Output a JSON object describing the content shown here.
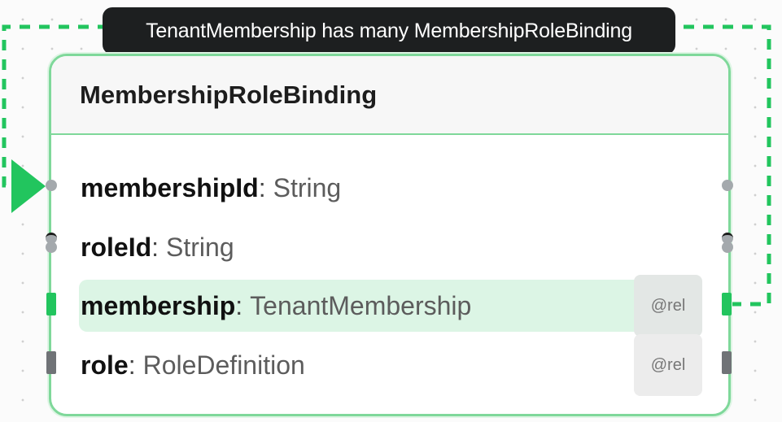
{
  "edge": {
    "label": "TenantMembership has many MembershipRoleBinding",
    "color": "#22c55e"
  },
  "node": {
    "title": "MembershipRoleBinding",
    "border_color": "#7fd89a",
    "fields": [
      {
        "name": "membershipId",
        "separator": ":",
        "type": "String",
        "badge": ""
      },
      {
        "name": "roleId",
        "separator": ":",
        "type": "String",
        "badge": ""
      },
      {
        "name": "membership",
        "separator": ":",
        "type": "TenantMembership",
        "badge": "@rel"
      },
      {
        "name": "role",
        "separator": ":",
        "type": "RoleDefinition",
        "badge": "@rel"
      }
    ]
  }
}
